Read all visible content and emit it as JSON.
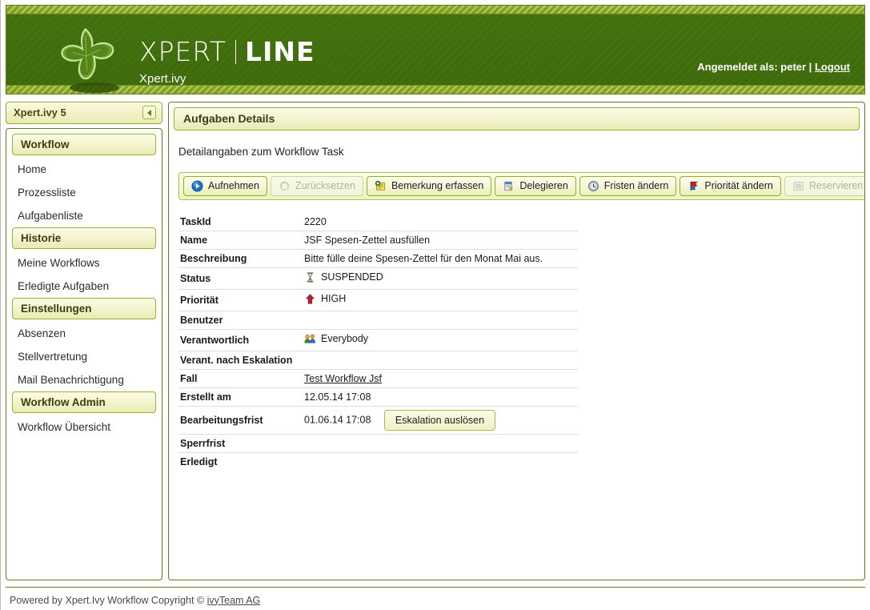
{
  "banner": {
    "brand_primary": "XPERT",
    "brand_secondary": "LINE",
    "brand_sub": "Xpert.ivy",
    "login_prefix": "Angemeldet als: peter |",
    "logout_label": "Logout",
    "colors": {
      "dark_green": "#40700c",
      "light_green_stripe": "#86a61c",
      "border_green": "#5d7d16",
      "panel_cream": "#f3f3cd"
    }
  },
  "sidebar": {
    "title": "Xpert.ivy 5",
    "collapse_icon": "chevron-left-icon",
    "groups": [
      {
        "header": "Workflow",
        "items": [
          "Home",
          "Prozessliste",
          "Aufgabenliste"
        ]
      },
      {
        "header": "Historie",
        "items": [
          "Meine Workflows",
          "Erledigte Aufgaben"
        ]
      },
      {
        "header": "Einstellungen",
        "items": [
          "Absenzen",
          "Stellvertretung",
          "Mail Benachrichtigung"
        ]
      },
      {
        "header": "Workflow Admin",
        "items": [
          "Workflow Übersicht"
        ]
      }
    ]
  },
  "content": {
    "title": "Aufgaben Details",
    "subtitle": "Detailangaben zum Workflow Task",
    "toolbar": [
      {
        "label": "Aufnehmen",
        "icon": "play-circle-icon",
        "disabled": false
      },
      {
        "label": "Zurücksetzen",
        "icon": "reset-arrows-icon",
        "disabled": true
      },
      {
        "label": "Bemerkung erfassen",
        "icon": "note-add-icon",
        "disabled": false
      },
      {
        "label": "Delegieren",
        "icon": "delegate-icon",
        "disabled": false
      },
      {
        "label": "Fristen ändern",
        "icon": "clock-icon",
        "disabled": false
      },
      {
        "label": "Priorität ändern",
        "icon": "priority-flag-icon",
        "disabled": false
      },
      {
        "label": "Reservieren",
        "icon": "reserve-square-icon",
        "disabled": true
      }
    ],
    "details": [
      {
        "label": "TaskId",
        "value": "2220",
        "icon": null,
        "link": false
      },
      {
        "label": "Name",
        "value": "JSF Spesen-Zettel ausfüllen",
        "icon": null,
        "link": false
      },
      {
        "label": "Beschreibung",
        "value": "Bitte fülle deine Spesen-Zettel für den Monat Mai aus.",
        "icon": null,
        "link": false
      },
      {
        "label": "Status",
        "value": "SUSPENDED",
        "icon": "hourglass-icon",
        "link": false
      },
      {
        "label": "Priorität",
        "value": "HIGH",
        "icon": "arrow-up-red-icon",
        "link": false
      },
      {
        "label": "Benutzer",
        "value": "",
        "icon": null,
        "link": false
      },
      {
        "label": "Verantwortlich",
        "value": "Everybody",
        "icon": "users-group-icon",
        "link": false
      },
      {
        "label": "Verant. nach Eskalation",
        "value": "",
        "icon": null,
        "link": false
      },
      {
        "label": "Fall",
        "value": "Test Workflow Jsf",
        "icon": null,
        "link": true
      },
      {
        "label": "Erstellt am",
        "value": "12.05.14 17:08",
        "icon": null,
        "link": false
      },
      {
        "label": "Bearbeitungsfrist",
        "value": "01.06.14 17:08",
        "icon": null,
        "link": false,
        "button": "Eskalation auslösen"
      },
      {
        "label": "Sperrfrist",
        "value": "",
        "icon": null,
        "link": false
      },
      {
        "label": "Erledigt",
        "value": "",
        "icon": null,
        "link": false
      }
    ]
  },
  "footer": {
    "text": "Powered by Xpert.Ivy Workflow Copyright ©",
    "link": "ivyTeam AG"
  }
}
